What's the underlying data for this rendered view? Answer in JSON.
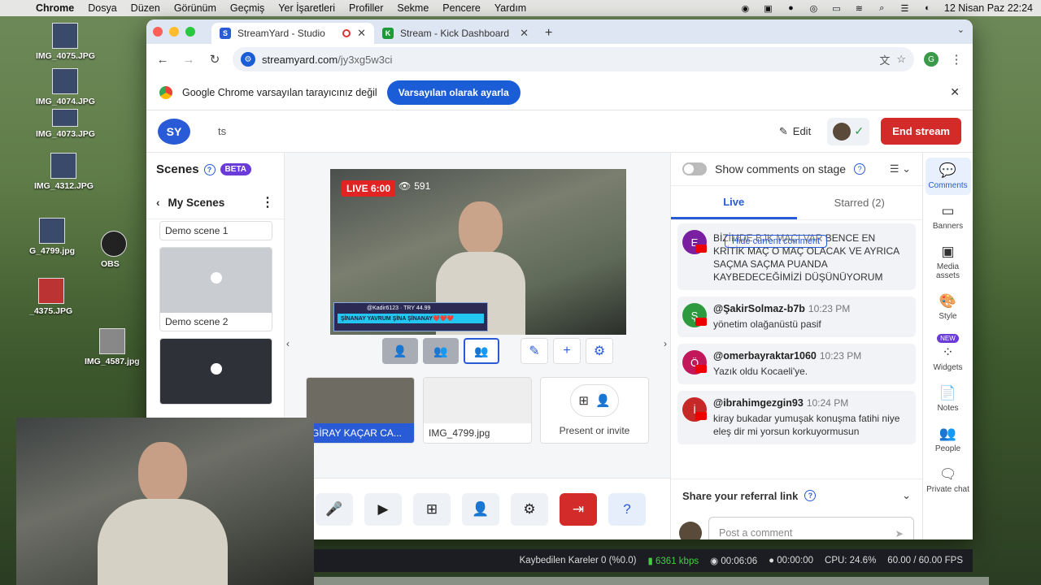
{
  "menubar": {
    "app": "Chrome",
    "items": [
      "Dosya",
      "Düzen",
      "Görünüm",
      "Geçmiş",
      "Yer İşaretleri",
      "Profiller",
      "Sekme",
      "Pencere",
      "Yardım"
    ],
    "clock": "12 Nisan Paz  22:24"
  },
  "desktop": {
    "icons": [
      "IMG_4075.JPG",
      "IMG_4074.JPG",
      "IMG_4073.JPG",
      "IMG_4312.JPG",
      "G_4799.jpg",
      "OBS",
      "_4375.JPG",
      "IMG_4587.jpg"
    ]
  },
  "browser": {
    "tabs": [
      {
        "label": "StreamYard - Studio",
        "favicon": "S"
      },
      {
        "label": "Stream - Kick Dashboard",
        "favicon": "K"
      }
    ],
    "url_domain": "streamyard.com",
    "url_path": "/jy3xg5w3ci",
    "profile_initial": "G",
    "infobar_text": "Google Chrome varsayılan tarayıcınız değil",
    "infobar_button": "Varsayılan olarak ayarla"
  },
  "app": {
    "logo": "SY",
    "broadcast_title": "ts",
    "edit_label": "Edit",
    "end_stream_label": "End stream",
    "scenes_title": "Scenes",
    "beta_label": "BETA",
    "my_scenes_label": "My Scenes",
    "scenes": [
      "Demo scene 1",
      "Demo scene 2"
    ],
    "live_label": "LIVE 6:00",
    "viewer_count": "591",
    "donation_user": "@Kadir6123",
    "donation_amount": "TRY 44.99",
    "donation_msg": "ŞİNANAY YAVRUM ŞİNA ŞİNANAY❤️❤️❤️",
    "sources": [
      {
        "label": "GİRAY KAÇAR CA..."
      },
      {
        "label": "IMG_4799.jpg"
      }
    ],
    "invite_label": "Present or invite"
  },
  "chat": {
    "show_comments_label": "Show comments on stage",
    "tab_live": "Live",
    "tab_starred": "Starred (2)",
    "hide_label": "Hide current comment",
    "comments": [
      {
        "author": "",
        "time": "",
        "text": "BİZİMDE BJK MAÇI VAR BENCE EN KRİTİK MAÇ O MAÇ OLACAK VE AYRICA SAÇMA SAÇMA PUANDA KAYBEDECEĞİMİZİ DÜŞÜNÜYORUM",
        "initial": "E",
        "color": "#7a1fa2"
      },
      {
        "author": "@ŞakirSolmaz-b7b",
        "time": "10:23 PM",
        "text": "yönetim olağanüstü pasif",
        "initial": "Ş",
        "color": "#2e9a3f"
      },
      {
        "author": "@omerbayraktar1060",
        "time": "10:23 PM",
        "text": "Yazık oldu Kocaeli'ye.",
        "initial": "Ö",
        "color": "#c2185b"
      },
      {
        "author": "@ibrahimgezgin93",
        "time": "10:24 PM",
        "text": "kiray bukadar yumuşak konuşma fatihi niye eleş dir mi yorsun korkuyormusun",
        "initial": "İ",
        "color": "#c62828"
      }
    ],
    "referral_label": "Share your referral link",
    "post_placeholder": "Post a comment"
  },
  "rail": [
    {
      "label": "Comments",
      "icon": "chat-icon"
    },
    {
      "label": "Banners",
      "icon": "banner-icon"
    },
    {
      "label": "Media assets",
      "icon": "media-icon"
    },
    {
      "label": "Style",
      "icon": "palette-icon"
    },
    {
      "label": "Widgets",
      "icon": "widgets-icon",
      "badge": "NEW"
    },
    {
      "label": "Notes",
      "icon": "notes-icon"
    },
    {
      "label": "People",
      "icon": "people-icon"
    },
    {
      "label": "Private chat",
      "icon": "private-chat-icon"
    }
  ],
  "obs_status": {
    "dropped": "Kaybedilen Kareler 0 (%0.0)",
    "bitrate": "6361 kbps",
    "stream_time": "00:06:06",
    "rec_time": "00:00:00",
    "cpu": "CPU: 24.6%",
    "fps": "60.00 / 60.00 FPS"
  }
}
